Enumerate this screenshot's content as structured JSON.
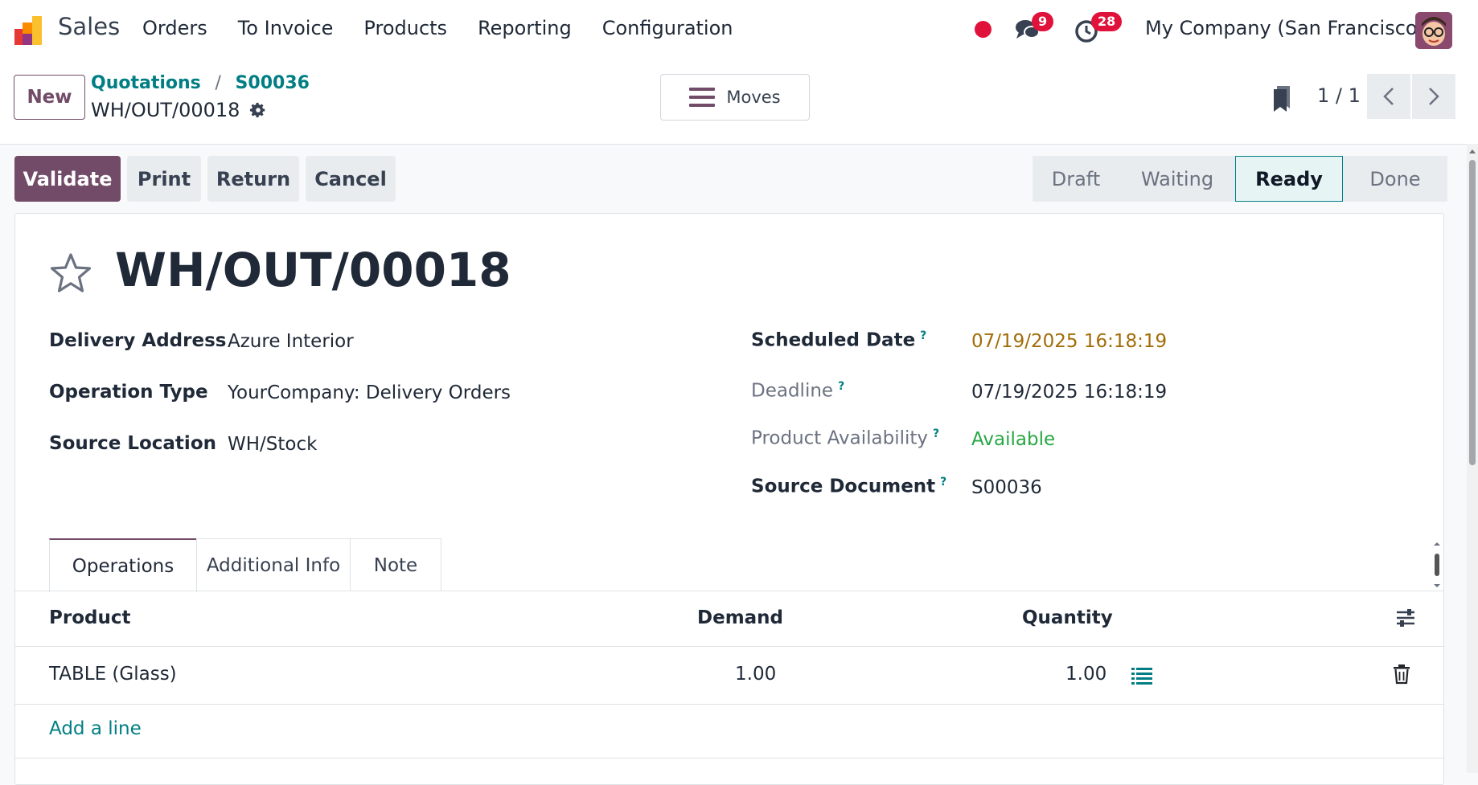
{
  "topbar": {
    "app_name": "Sales",
    "menu": [
      "Orders",
      "To Invoice",
      "Products",
      "Reporting",
      "Configuration"
    ],
    "chat_count": "9",
    "activity_count": "28",
    "company": "My Company (San Francisco)"
  },
  "control_panel": {
    "new_label": "New",
    "breadcrumb": [
      "Quotations",
      "S00036"
    ],
    "record_name": "WH/OUT/00018",
    "moves_label": "Moves",
    "pager_value": "1 / 1"
  },
  "actions": {
    "validate": "Validate",
    "print": "Print",
    "return": "Return",
    "cancel": "Cancel"
  },
  "statusbar": {
    "states": [
      "Draft",
      "Waiting",
      "Ready",
      "Done"
    ],
    "active": "Ready"
  },
  "form": {
    "title": "WH/OUT/00018",
    "left_fields": [
      {
        "label": "Delivery Address",
        "value": "Azure Interior"
      },
      {
        "label": "Operation Type",
        "value": "YourCompany: Delivery Orders"
      },
      {
        "label": "Source Location",
        "value": "WH/Stock"
      }
    ],
    "right_fields": [
      {
        "label": "Scheduled Date",
        "value": "07/19/2025 16:18:19",
        "help": "?"
      },
      {
        "label": "Deadline",
        "value": "07/19/2025 16:18:19",
        "help": "?"
      },
      {
        "label": "Product Availability",
        "value": "Available",
        "help": "?"
      },
      {
        "label": "Source Document",
        "value": "S00036",
        "help": "?"
      }
    ]
  },
  "tabs": [
    "Operations",
    "Additional Info",
    "Note"
  ],
  "table": {
    "headers": {
      "product": "Product",
      "demand": "Demand",
      "quantity": "Quantity"
    },
    "rows": [
      {
        "product": "TABLE (Glass)",
        "demand": "1.00",
        "quantity": "1.00"
      }
    ],
    "add_line": "Add a line"
  },
  "colors": {
    "primary": "#714b67",
    "link": "#017e84",
    "warning": "#a26c07",
    "success": "#28a745",
    "badge": "#e0113a"
  }
}
